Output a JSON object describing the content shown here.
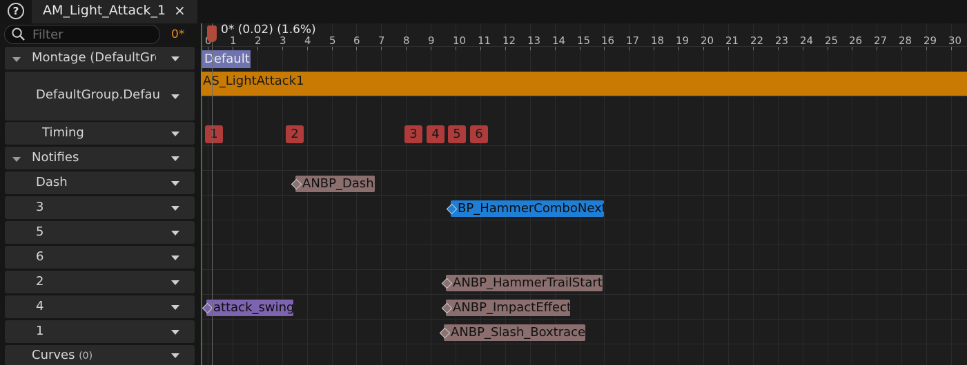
{
  "tab": {
    "title": "AM_Light_Attack_1",
    "close_glyph": "×",
    "help_glyph": "?"
  },
  "filter": {
    "placeholder": "Filter",
    "modified": "0*"
  },
  "tracks": {
    "montage": "Montage (DefaultGroup)",
    "slot": "DefaultGroup.DefaultSlot",
    "timing": "Timing",
    "notifies": "Notifies",
    "notify_tracks": [
      "Dash",
      "3",
      "5",
      "6",
      "2",
      "4",
      "1"
    ],
    "curves": "Curves",
    "curves_count": "(0)"
  },
  "timeline": {
    "playhead": "0* (0.02) (1.6%)",
    "ticks": [
      "0",
      "1",
      "2",
      "3",
      "4",
      "5",
      "6",
      "7",
      "8",
      "9",
      "10",
      "11",
      "12",
      "13",
      "14",
      "15",
      "16",
      "17",
      "18",
      "19",
      "20",
      "21",
      "22",
      "23",
      "24",
      "25",
      "26",
      "27",
      "28",
      "29",
      "30"
    ],
    "section": "Default",
    "segment": "AS_LightAttack1",
    "timing_markers": [
      "1",
      "2",
      "3",
      "4",
      "5",
      "6"
    ],
    "notifies": [
      {
        "label": "ANBP_Dash",
        "track": "Dash"
      },
      {
        "label": "BP_HammerComboNext",
        "track": "3"
      },
      {
        "label": "ANBP_HammerTrailStart",
        "track": "2"
      },
      {
        "label": "attack_swing",
        "track": "4"
      },
      {
        "label": "ANBP_ImpactEffect",
        "track": "4"
      },
      {
        "label": "ANBP_Slash_Boxtrace",
        "track": "1"
      }
    ]
  },
  "colors": {
    "segment": "#c87a03",
    "section": "#6f73b0",
    "timing_marker": "#b03b3b",
    "notify_default": "#8b6e6e",
    "notify_blueprint": "#1f7fd6",
    "notify_sound": "#7d63b0",
    "modified": "#e58a1f"
  }
}
